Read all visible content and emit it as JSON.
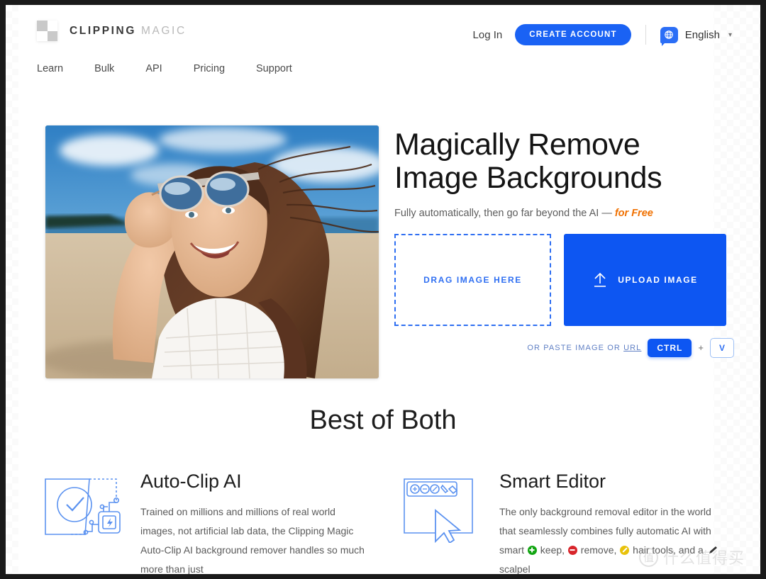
{
  "header": {
    "logo": {
      "primary": "CLIPPING",
      "secondary": "MAGIC",
      "icon": "checkerboard-logo-icon"
    },
    "login_label": "Log In",
    "create_account_label": "CREATE ACCOUNT",
    "language": {
      "icon": "globe-icon",
      "label": "English",
      "caret": "⌄"
    },
    "nav": [
      {
        "label": "Learn"
      },
      {
        "label": "Bulk"
      },
      {
        "label": "API"
      },
      {
        "label": "Pricing"
      },
      {
        "label": "Support"
      }
    ]
  },
  "hero": {
    "photo_alt": "smiling-woman-beach-sunglasses-photo",
    "title_line1": "Magically Remove",
    "title_line2": "Image Backgrounds",
    "subtitle_prefix": "Fully automatically, then go far beyond the AI — ",
    "subtitle_highlight": "for Free",
    "drag_label": "DRAG IMAGE HERE",
    "upload_label": "UPLOAD IMAGE",
    "upload_icon": "upload-arrow-icon",
    "paste_prefix": "OR PASTE IMAGE OR ",
    "paste_link": "URL",
    "key_ctrl": "CTRL",
    "key_plus": "+",
    "key_v": "V"
  },
  "best_of_both": {
    "title": "Best of Both",
    "features": [
      {
        "icon": "auto-clip-ai-icon",
        "title": "Auto-Clip AI",
        "text": "Trained on millions and millions of real world images, not artificial lab data, the Clipping Magic Auto-Clip AI background remover handles so much more than just"
      },
      {
        "icon": "smart-editor-icon",
        "title": "Smart Editor",
        "text_part1": "The only background removal editor in the world that seamlessly combines fully automatic AI with smart ",
        "text_keep": " keep, ",
        "text_remove": " remove, ",
        "text_hair": " hair tools, and a ",
        "text_end": " scalpel"
      }
    ]
  },
  "watermark": {
    "mark": "值",
    "text": "什么值得买"
  },
  "colors": {
    "accent_blue": "#0d56f2",
    "button_blue": "#1a62f4",
    "orange": "#f07000",
    "icon_blue": "#5b92f0",
    "keep_green": "#12a512",
    "remove_red": "#d8252b",
    "hair_yellow": "#e8c20a"
  }
}
